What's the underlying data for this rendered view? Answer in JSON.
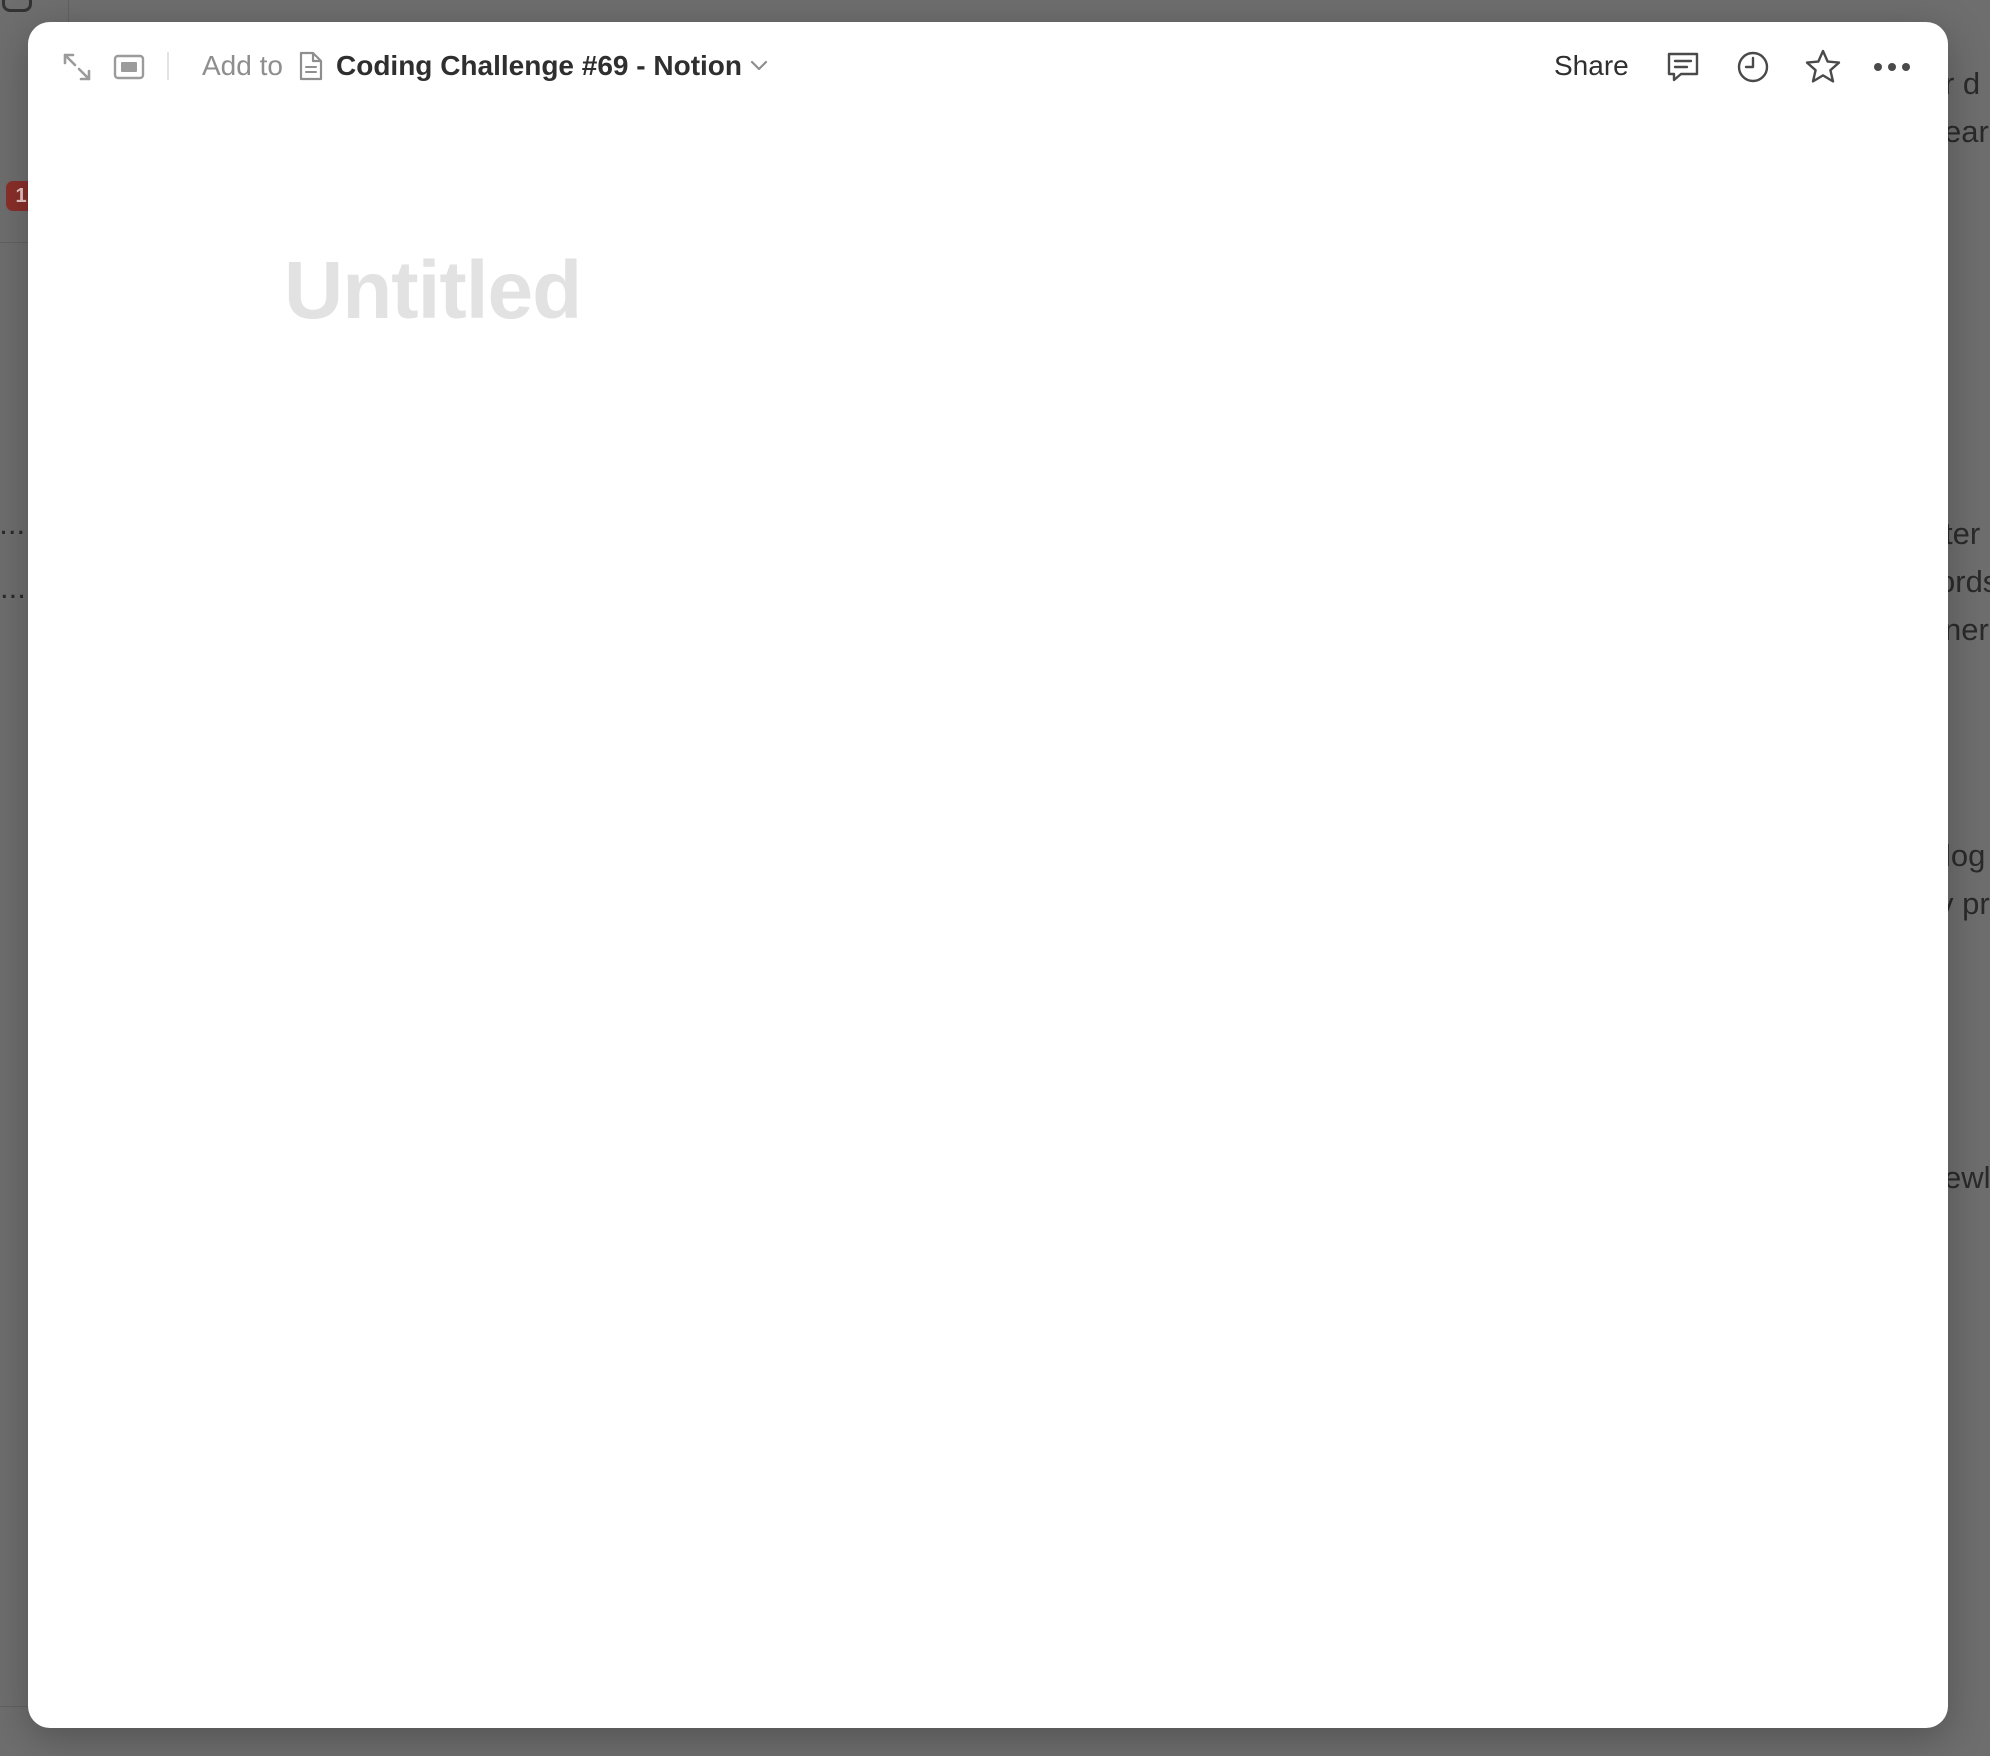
{
  "background": {
    "left_badge": "1",
    "left_fragments": [
      "o...",
      "..."
    ],
    "right_fragments": [
      "r d",
      "ear",
      "ter",
      "ords",
      "ner",
      "log",
      "v pr",
      "ewl"
    ]
  },
  "topbar": {
    "add_to_label": "Add to",
    "breadcrumb_title": "Coding Challenge #69 - Notion",
    "share_label": "Share"
  },
  "page": {
    "title_placeholder": "Untitled"
  }
}
